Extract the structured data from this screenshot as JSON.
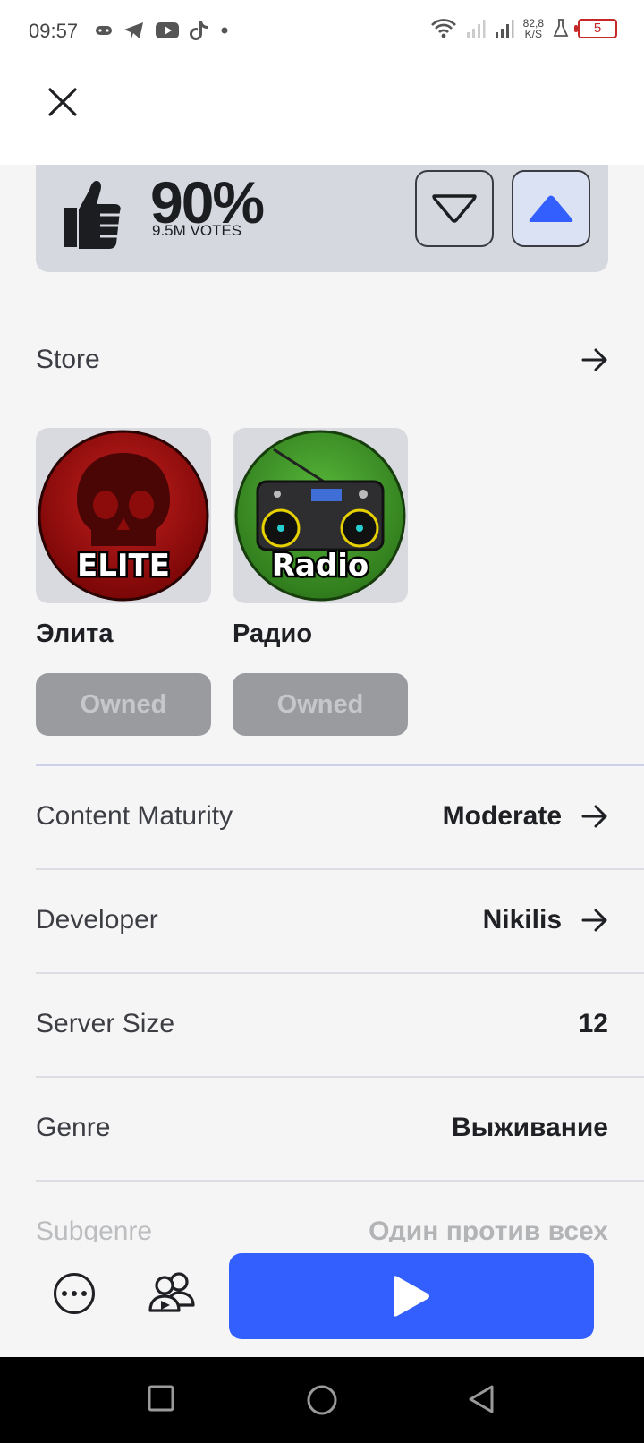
{
  "status_bar": {
    "time": "09:57",
    "speed_value": "82,8",
    "speed_unit": "K/S",
    "battery": "5",
    "icons_left": [
      "gamepad-icon",
      "telegram-icon",
      "youtube-icon",
      "tiktok-icon",
      "dot-icon"
    ],
    "icons_right": [
      "wifi-icon",
      "signal-icon",
      "signal-icon",
      "speed-readout",
      "flask-icon",
      "battery-icon"
    ]
  },
  "header": {
    "close_icon": "close-icon"
  },
  "rating": {
    "percent": "90%",
    "votes": "9.5M VOTES",
    "accent_color": "#335fff"
  },
  "store": {
    "label": "Store",
    "items": [
      {
        "name": "Элита",
        "badge_text": "ELITE",
        "button": "Owned"
      },
      {
        "name": "Радио",
        "badge_text": "Radio",
        "button": "Owned"
      }
    ]
  },
  "info": [
    {
      "label": "Content Maturity",
      "value": "Moderate",
      "has_arrow": true
    },
    {
      "label": "Developer",
      "value": "Nikilis",
      "has_arrow": true
    },
    {
      "label": "Server Size",
      "value": "12",
      "has_arrow": false
    },
    {
      "label": "Genre",
      "value": "Выживание",
      "has_arrow": false
    },
    {
      "label": "Subgenre",
      "value": "Один против всех",
      "has_arrow": false
    }
  ],
  "actions": {
    "more_icon": "more-icon",
    "party_icon": "party-icon",
    "play_icon": "play-icon",
    "play_color": "#335fff"
  },
  "nav": [
    "recents-icon",
    "home-icon",
    "back-icon"
  ]
}
